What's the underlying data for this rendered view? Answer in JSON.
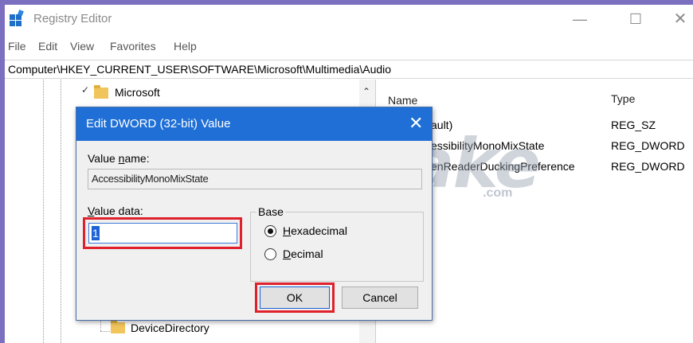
{
  "window": {
    "title": "Registry Editor",
    "controls": {
      "minimize": "—",
      "maximize": "☐",
      "close": "✕"
    }
  },
  "menu": [
    "File",
    "Edit",
    "View",
    "Favorites",
    "Help"
  ],
  "address": "Computer\\HKEY_CURRENT_USER\\SOFTWARE\\Microsoft\\Multimedia\\Audio",
  "tree": {
    "items": [
      {
        "label": "Microsoft",
        "expanded": true
      },
      {
        "label": "DeviceDirectory"
      }
    ]
  },
  "list": {
    "columns": {
      "name": "Name",
      "type": "Type"
    },
    "rows": [
      {
        "name": "ault)",
        "type": "REG_SZ"
      },
      {
        "name": "essibilityMonoMixState",
        "type": "REG_DWORD"
      },
      {
        "name": "enReaderDuckingPreference",
        "type": "REG_DWORD"
      }
    ]
  },
  "watermark": {
    "text": "TipsMake",
    "suffix": ".com"
  },
  "dialog": {
    "title": "Edit DWORD (32-bit) Value",
    "close": "✕",
    "value_name_label": {
      "prefix": "Value ",
      "accel": "n",
      "suffix": "ame:"
    },
    "value_name": "AccessibilityMonoMixState",
    "value_data_label": {
      "prefix": "",
      "accel": "V",
      "suffix": "alue data:"
    },
    "value_data": "1",
    "base_label": "Base",
    "base_options": [
      {
        "accel": "H",
        "rest": "exadecimal",
        "selected": true
      },
      {
        "accel": "D",
        "rest": "ecimal",
        "selected": false
      }
    ],
    "ok_label": "OK",
    "cancel_label": "Cancel"
  },
  "colors": {
    "accent": "#1f6fd6",
    "highlight_border": "#e0202a",
    "folder": "#f2c55c",
    "frame": "#7b6fc0"
  },
  "icons": {
    "app": "registry-editor-icon",
    "folder": "folder-icon",
    "chevron": "chevron-down-icon",
    "scroll_up": "scroll-up-arrow-icon"
  }
}
